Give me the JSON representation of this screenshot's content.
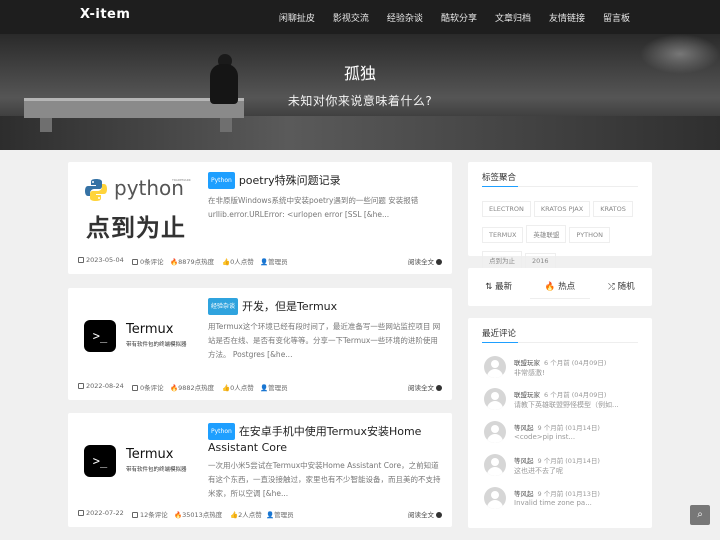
{
  "site": {
    "logo": "X-item"
  },
  "nav": [
    "闲聊扯皮",
    "影视交流",
    "经验杂谈",
    "酷软分享",
    "文章归档",
    "友情链接",
    "留言板"
  ],
  "hero": {
    "title": "孤独",
    "subtitle": "未知对你来说意味着什么?"
  },
  "posts": [
    {
      "tag": "Python",
      "tag_color": "#1e9fff",
      "title": "poetry特殊问题记录",
      "excerpt": "在非原版Windows系统中安装poetry遇到的一些问题 安装报错 urllib.error.URLError: <urlopen error [SSL [&he...",
      "thumb": {
        "brand": "python",
        "caption": "点到为止",
        "small": "TRADEMARK"
      },
      "date": "2023-05-04",
      "comments": "0条评论",
      "heat": "8879点热度",
      "likes": "0人点赞",
      "author": "管理员",
      "read_more": "阅读全文"
    },
    {
      "tag": "经验杂谈",
      "tag_color": "#2fa3de",
      "title": "开发，但是Termux",
      "excerpt": "用Termux这个环境已经有段时间了，最近准备写一些网站监控项目 网站是否在线、是否有变化等等。分享一下Termux一些环境的进阶使用方法。 Postgres [&he...",
      "thumb": {
        "brand": "Termux",
        "caption": "带有软件包的终端模拟器",
        "glyph": ">_"
      },
      "date": "2022-08-24",
      "comments": "0条评论",
      "heat": "9882点热度",
      "likes": "0人点赞",
      "author": "管理员",
      "read_more": "阅读全文"
    },
    {
      "tag": "Python",
      "tag_color": "#1e9fff",
      "title": "在安卓手机中使用Termux安装Home Assistant Core",
      "excerpt": "一次用小米5尝试在Termux中安装Home Assistant Core，之前知道有这个东西，一直没接触过，家里也有不少智能设备，而且美的不支持米家，所以空调 [&he...",
      "thumb": {
        "brand": "Termux",
        "caption": "带有软件包的终端模拟器",
        "glyph": ">_"
      },
      "date": "2022-07-22",
      "comments": "12条评论",
      "heat": "35013点热度",
      "likes": "2人点赞",
      "author": "管理员",
      "read_more": "阅读全文"
    }
  ],
  "tag_widget": {
    "title": "标签聚合",
    "tags": [
      "ELECTRON",
      "KRATOS PJAX",
      "KRATOS",
      "TERMUX",
      "英雄联盟",
      "PYTHON",
      "点到为止",
      "2016"
    ]
  },
  "tabs_widget": {
    "tabs": [
      "最新",
      "热点",
      "随机"
    ]
  },
  "comments_widget": {
    "title": "最近评论",
    "items": [
      {
        "user": "联盟玩家",
        "time": "6 个月前 (04月09日)",
        "text": "非常感激!"
      },
      {
        "user": "联盟玩家",
        "time": "6 个月前 (04月09日)",
        "text": "请教下英雄联盟野怪模型（例如..."
      },
      {
        "user": "等风起",
        "time": "9 个月前 (01月14日)",
        "text": "<code>pip inst..."
      },
      {
        "user": "等风起",
        "time": "9 个月前 (01月14日)",
        "text": "这也进不去了呢"
      },
      {
        "user": "等风起",
        "time": "9 个月前 (01月13日)",
        "text": "Invalid time zone pa..."
      }
    ]
  }
}
